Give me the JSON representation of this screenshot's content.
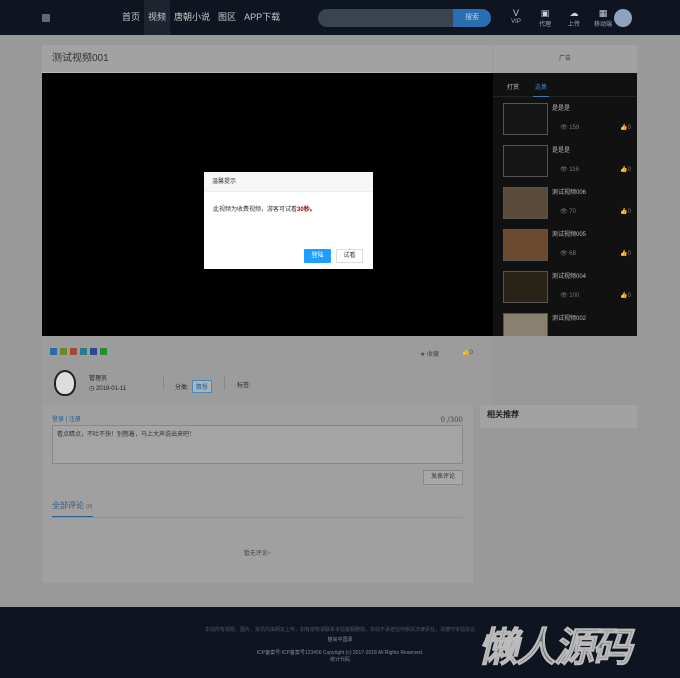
{
  "header": {
    "nav": [
      "首页",
      "视频",
      "唐朝小说",
      "图区",
      "APP下载"
    ],
    "search_button": "搜索",
    "icons": [
      {
        "label": "VIP",
        "icon": "vip-icon",
        "glyph": "V"
      },
      {
        "label": "代理",
        "icon": "agent-icon",
        "glyph": "▣"
      },
      {
        "label": "上传",
        "icon": "upload-icon",
        "glyph": "☁"
      },
      {
        "label": "移动端",
        "icon": "qrcode-icon",
        "glyph": "▦"
      }
    ]
  },
  "video": {
    "title": "测试视频001",
    "ad": "广告"
  },
  "playlist": {
    "tabs": [
      "打赏",
      "选集"
    ],
    "items": [
      {
        "title": "是是是",
        "views": "159",
        "likes": "0"
      },
      {
        "title": "是是是",
        "views": "116",
        "likes": "0"
      },
      {
        "title": "测试视频006",
        "views": "70",
        "likes": "0"
      },
      {
        "title": "测试视频005",
        "views": "68",
        "likes": "0"
      },
      {
        "title": "测试视频004",
        "views": "100",
        "likes": "0"
      },
      {
        "title": "测试视频002",
        "views": "",
        "likes": ""
      }
    ]
  },
  "actions": {
    "favorite": "收藏",
    "likes": "0"
  },
  "author": {
    "name": "管理员",
    "date": "2019-01-11",
    "category_label": "分类:",
    "category": "猜想",
    "tags_label": "标签:"
  },
  "comments": {
    "login": "登录",
    "register": "注册",
    "count": "0 /300",
    "placeholder": "看点睛点，不吐不快！别憋着，马上大声说出来吧！",
    "post": "发表评论",
    "all": "全部评论",
    "all_count": "(0)",
    "empty": "暂无评论~"
  },
  "related": {
    "title": "相关推荐"
  },
  "modal": {
    "title": "温馨提示",
    "text": "此视频为收费视频，游客可试看",
    "highlight": "30秒。",
    "login": "登陆",
    "try": "试看"
  },
  "footer": {
    "notice": "本站所有视频、图片、资讯均由网友上传，如有侵权请联系本站客服删除，本站不承担任何相关法律责任，请遵守本站协议",
    "line2": "猫尚中国源",
    "copyright": "ICP备案号:ICP备案号123456   Copyright (c) 2017-2018 All Rights Reserved.",
    "stats": "统计代码",
    "watermark": "懒人源码"
  }
}
